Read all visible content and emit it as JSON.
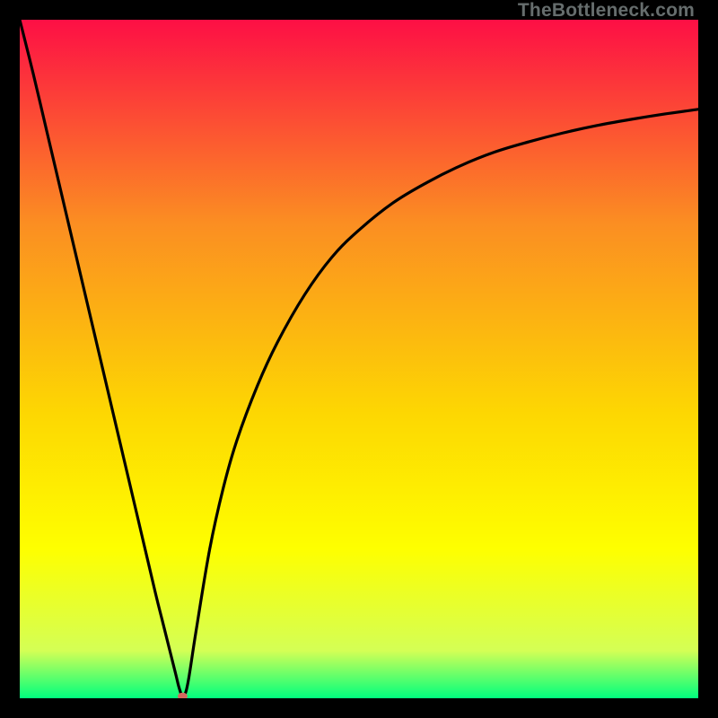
{
  "watermark": "TheBottleneck.com",
  "chart_data": {
    "type": "line",
    "title": "",
    "xlabel": "",
    "ylabel": "",
    "xlim": [
      0,
      100
    ],
    "ylim": [
      0,
      100
    ],
    "grid": false,
    "legend": false,
    "background_gradient": {
      "top": "#fd0f45",
      "upper_mid": "#fb8e22",
      "mid": "#fdd702",
      "lower_mid": "#feff00",
      "near_bottom": "#d4ff55",
      "bottom": "#00ff7e"
    },
    "series": [
      {
        "name": "curve",
        "color": "#000000",
        "x": [
          0,
          2,
          4,
          6,
          8,
          10,
          12,
          14,
          16,
          18,
          20,
          21,
          22,
          23,
          23.5,
          24,
          24.5,
          25,
          26,
          28,
          30,
          32,
          35,
          38,
          42,
          46,
          50,
          55,
          60,
          65,
          70,
          75,
          80,
          85,
          90,
          95,
          100
        ],
        "y": [
          100,
          92,
          83.5,
          75,
          66.5,
          58,
          49.5,
          41,
          32.5,
          24,
          15.5,
          11.5,
          7.5,
          3.5,
          1.5,
          0.3,
          1.0,
          3.5,
          10,
          22,
          31,
          38,
          46,
          52.5,
          59.5,
          65,
          69,
          73,
          76,
          78.5,
          80.5,
          82,
          83.3,
          84.4,
          85.3,
          86.1,
          86.8
        ]
      }
    ],
    "marker": {
      "name": "min-point",
      "x": 24,
      "y": 0.3,
      "color": "#d46a5f",
      "rx": 5.5,
      "ry": 4
    }
  }
}
